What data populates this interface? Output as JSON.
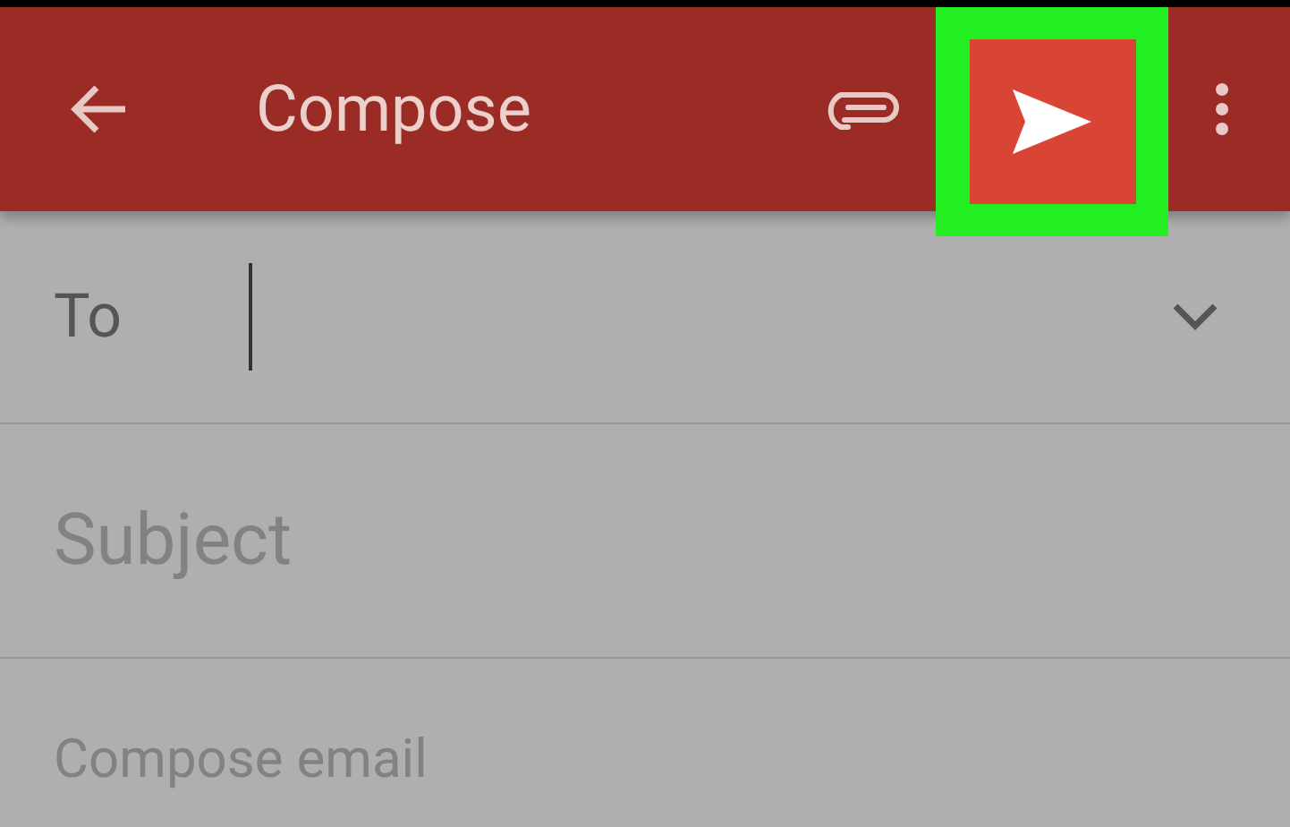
{
  "app_bar": {
    "title": "Compose",
    "send_highlighted": true
  },
  "to_field": {
    "label": "To"
  },
  "subject_field": {
    "placeholder": "Subject"
  },
  "body_field": {
    "placeholder": "Compose email"
  }
}
